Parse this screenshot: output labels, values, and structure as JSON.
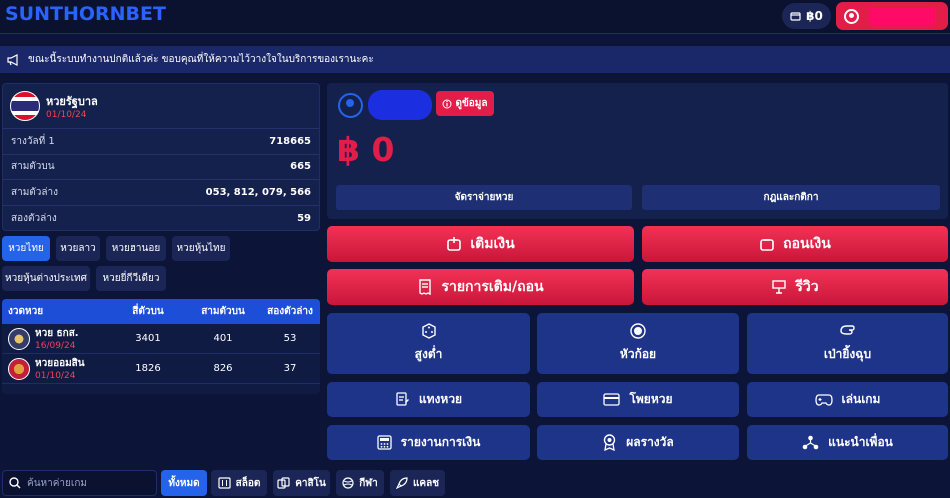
{
  "header": {
    "logo": "SUNTHORNBET",
    "balance": "฿0"
  },
  "announcement": "ขณะนี้ระบบทำงานปกติแล้วค่ะ ขอบคุณที่ให้ความไว้วางใจในบริการของเรานะคะ",
  "lottery": {
    "title": "หวยรัฐบาล",
    "date": "01/10/24",
    "rows": [
      {
        "label": "รางวัลที่ 1",
        "value": "718665"
      },
      {
        "label": "สามตัวบน",
        "value": "665"
      },
      {
        "label": "สามตัวล่าง",
        "value": "053, 812, 079, 566"
      },
      {
        "label": "สองตัวล่าง",
        "value": "59"
      }
    ]
  },
  "tabs": [
    "หวยไทย",
    "หวยลาว",
    "หวยฮานอย",
    "หวยหุ้นไทย",
    "หวยหุ้นต่างประเทศ",
    "หวยยี่กีวีเดียว"
  ],
  "results": {
    "headers": [
      "งวดหวย",
      "สี่ตัวบน",
      "สามตัวบน",
      "สองตัวล่าง"
    ],
    "rows": [
      {
        "name": "หวย ธกส.",
        "date": "16/09/24",
        "four": "3401",
        "three": "401",
        "two": "53"
      },
      {
        "name": "หวยออมสิน",
        "date": "01/10/24",
        "four": "1826",
        "three": "826",
        "two": "37"
      }
    ]
  },
  "user_panel": {
    "info_button": "ดูข้อมูล",
    "balance": "฿ 0",
    "buttons": [
      "จัดราจ่ายหวย",
      "กฎและกติกา"
    ]
  },
  "actions": {
    "deposit": "เติมเงิน",
    "withdraw": "ถอนเงิน",
    "transactions": "รายการเติม/ถอน",
    "review": "รีวิว"
  },
  "tiles": {
    "hilo": "สูงต่ำ",
    "coin": "หัวก้อย",
    "rps": "เป่ายิ้งฉุบ",
    "bet": "แทงหวย",
    "poy": "โพยหวย",
    "games": "เล่นเกม",
    "finance": "รายงานการเงิน",
    "prize": "ผลรางวัล",
    "invite": "แนะนำเพื่อน"
  },
  "bottom": {
    "search_placeholder": "ค้นหาค่ายเกม",
    "tabs": [
      "ทั้งหมด",
      "สล็อต",
      "คาสิโน",
      "กีฬา",
      "แคลช"
    ]
  },
  "colors": {
    "brand": "#2a62ff",
    "accent_red": "#e11d48",
    "bg": "#0c1538"
  }
}
